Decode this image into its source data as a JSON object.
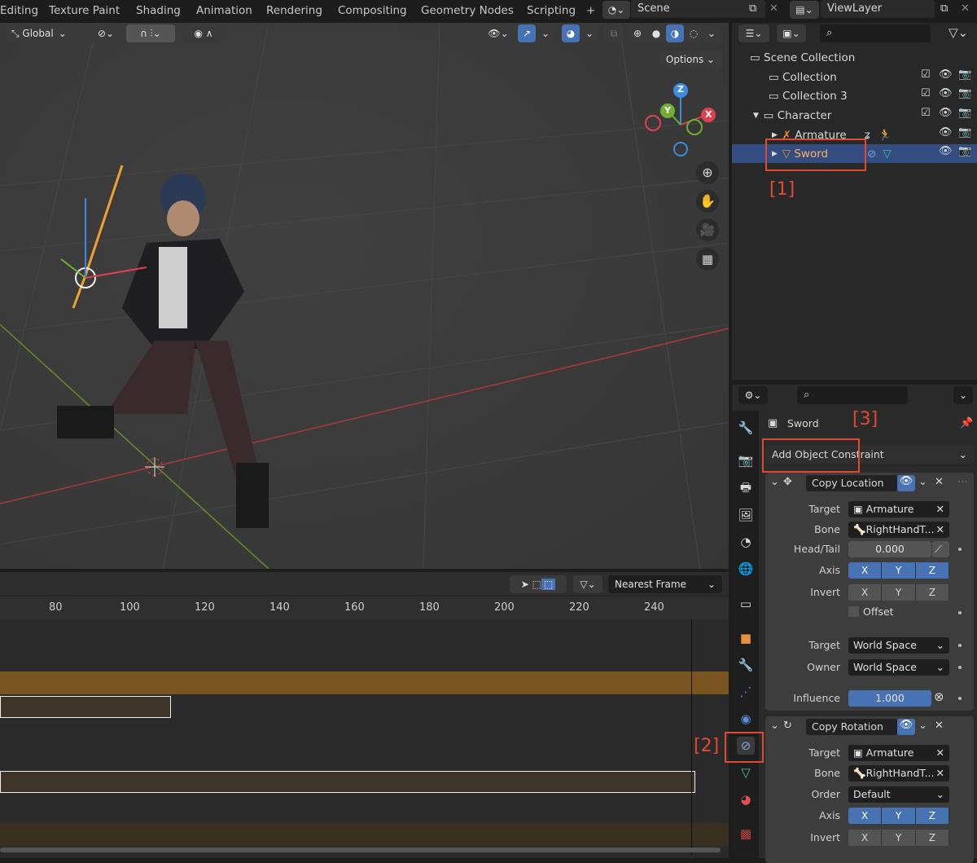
{
  "topbar": {
    "tabs": [
      "Editing",
      "Texture Paint",
      "Shading",
      "Animation",
      "Rendering",
      "Compositing",
      "Geometry Nodes",
      "Scripting"
    ],
    "scene": "Scene",
    "view_layer": "ViewLayer"
  },
  "viewport": {
    "transform_orientation": "Global",
    "options": "Options",
    "gizmo_axes": [
      "X",
      "Y",
      "Z"
    ]
  },
  "outliner": {
    "rows": [
      {
        "label": "Scene Collection"
      },
      {
        "label": "Collection"
      },
      {
        "label": "Collection 3"
      },
      {
        "label": "Character"
      },
      {
        "label": "Armature"
      },
      {
        "label": "Sword",
        "selected": true
      }
    ],
    "selection_color": "#334d80"
  },
  "annotations": [
    "[1]",
    "[2]",
    "[3]"
  ],
  "annotation_color": "#e04a2f",
  "properties": {
    "object_name": "Sword",
    "add_constraint": "Add Object Constraint",
    "copy_location": {
      "name": "Copy Location",
      "target_label": "Target",
      "target": "Armature",
      "bone_label": "Bone",
      "bone": "RightHandT...",
      "headtail_label": "Head/Tail",
      "headtail": "0.000",
      "axis_label": "Axis",
      "invert_label": "Invert",
      "axes": [
        "X",
        "Y",
        "Z"
      ],
      "offset": "Offset",
      "target_space_label": "Target",
      "target_space": "World Space",
      "owner_space_label": "Owner",
      "owner_space": "World Space",
      "influence_label": "Influence",
      "influence": "1.000"
    },
    "copy_rotation": {
      "name": "Copy Rotation",
      "target_label": "Target",
      "target": "Armature",
      "bone_label": "Bone",
      "bone": "RightHandT...",
      "order_label": "Order",
      "order": "Default",
      "axis_label": "Axis",
      "invert_label": "Invert"
    }
  },
  "timeline": {
    "snap": "Nearest Frame",
    "ticks": [
      "80",
      "100",
      "120",
      "140",
      "160",
      "180",
      "200",
      "220",
      "240"
    ]
  }
}
